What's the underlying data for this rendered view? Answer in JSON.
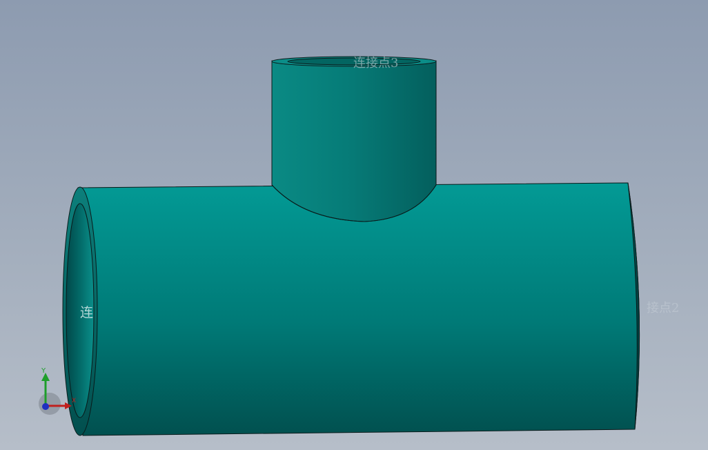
{
  "model": {
    "body_color": "#00837f",
    "edge_color": "#0a1a1a",
    "background_top": "#8d9bb0",
    "background_bottom": "#b6bec9"
  },
  "labels": {
    "port_left": "连",
    "port_top": "连接点3",
    "port_right": "接点2"
  },
  "triad": {
    "y_label": "Y",
    "x_label": "X",
    "z_label": "Z",
    "y_color": "#1e9e2a",
    "x_color": "#c0201e",
    "z_color": "#2030c0"
  }
}
